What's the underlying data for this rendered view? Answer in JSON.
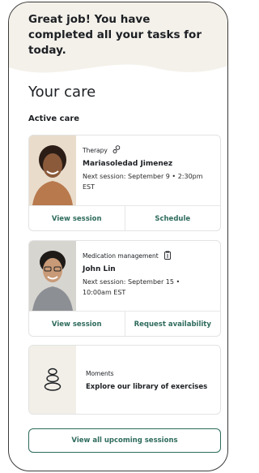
{
  "banner": {
    "message": "Great job! You have completed all your tasks for today."
  },
  "care": {
    "title": "Your care",
    "subtitle": "Active care"
  },
  "cards": [
    {
      "type": "Therapy",
      "type_icon": "therapy-icon",
      "name": "Mariasoledad Jimenez",
      "next_session": "Next session: September 9 • 2:30pm EST",
      "action_primary": "View session",
      "action_secondary": "Schedule"
    },
    {
      "type": "Medication management",
      "type_icon": "clipboard-icon",
      "name": "John Lin",
      "next_session": "Next session: September 15 • 10:00am EST",
      "action_primary": "View session",
      "action_secondary": "Request availability"
    }
  ],
  "moments": {
    "label": "Moments",
    "description": "Explore our library of exercises",
    "icon": "stacked-stones-icon"
  },
  "footer": {
    "all_sessions_label": "View all upcoming sessions"
  },
  "colors": {
    "accent": "#2e6b5c",
    "banner_bg": "#f4f1ea",
    "border": "#e3e3e3"
  }
}
